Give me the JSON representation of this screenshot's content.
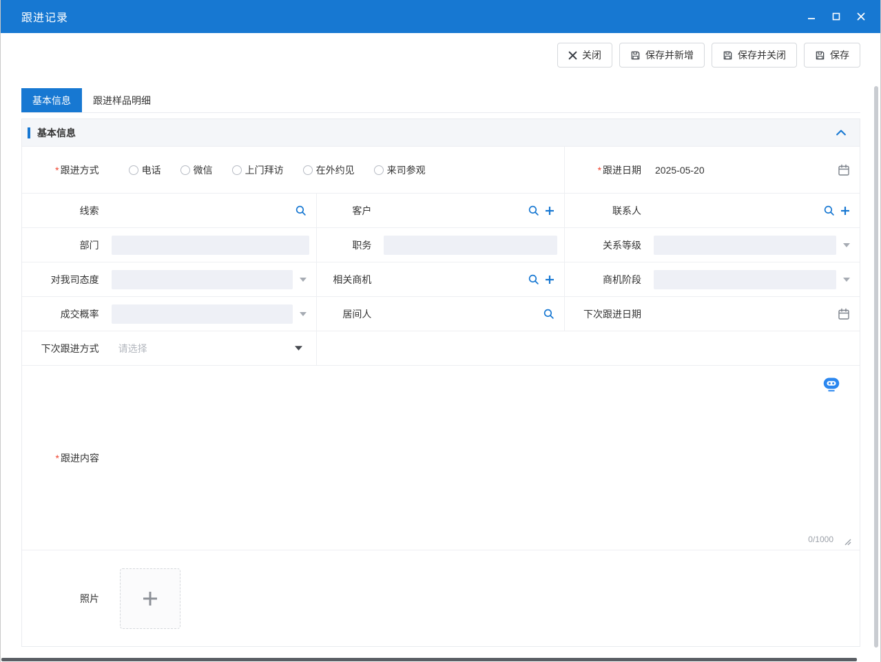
{
  "window": {
    "title": "跟进记录"
  },
  "toolbar": {
    "close": "关闭",
    "save_and_new": "保存并新增",
    "save_and_close": "保存并关闭",
    "save": "保存"
  },
  "tabs": [
    {
      "label": "基本信息"
    },
    {
      "label": "跟进样品明细"
    }
  ],
  "section": {
    "title": "基本信息"
  },
  "ui": {
    "required_marker": "*"
  },
  "form": {
    "follow_method": {
      "label": "跟进方式",
      "options": [
        "电话",
        "微信",
        "上门拜访",
        "在外约见",
        "来司参观"
      ]
    },
    "follow_date": {
      "label": "跟进日期",
      "value": "2025-05-20"
    },
    "lead": {
      "label": "线索",
      "value": ""
    },
    "customer": {
      "label": "客户",
      "value": ""
    },
    "contact": {
      "label": "联系人",
      "value": ""
    },
    "department": {
      "label": "部门",
      "value": ""
    },
    "job_title": {
      "label": "职务",
      "value": ""
    },
    "relation_level": {
      "label": "关系等级",
      "value": ""
    },
    "attitude": {
      "label": "对我司态度",
      "value": ""
    },
    "opportunity": {
      "label": "相关商机",
      "value": ""
    },
    "opportunity_stage": {
      "label": "商机阶段",
      "value": ""
    },
    "deal_probability": {
      "label": "成交概率",
      "value": ""
    },
    "intermediary": {
      "label": "居间人",
      "value": ""
    },
    "next_follow_date": {
      "label": "下次跟进日期",
      "value": ""
    },
    "next_follow_method": {
      "label": "下次跟进方式",
      "placeholder": "请选择"
    },
    "follow_content": {
      "label": "跟进内容",
      "value": "",
      "counter": "0/1000"
    },
    "photo": {
      "label": "照片"
    }
  }
}
